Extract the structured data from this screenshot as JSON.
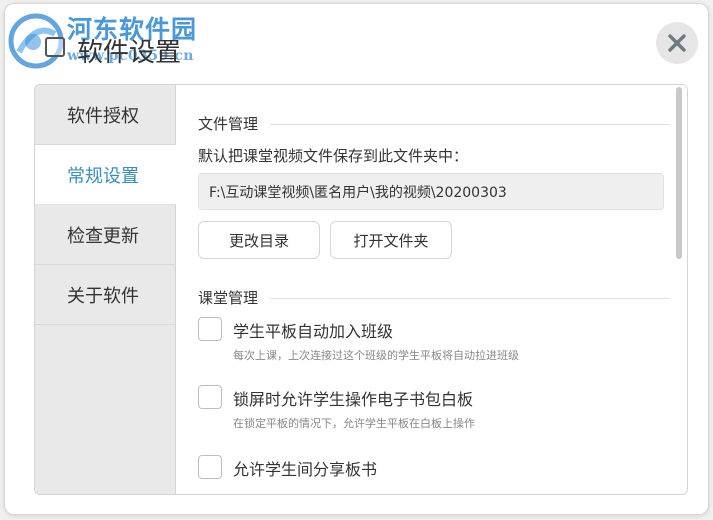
{
  "watermark": {
    "site_name": "河东软件园",
    "site_url": "www.pc0359.cn"
  },
  "header": {
    "title": "软件设置",
    "close_icon": "close-icon"
  },
  "sidebar": {
    "items": [
      {
        "label": "软件授权",
        "active": false
      },
      {
        "label": "常规设置",
        "active": true
      },
      {
        "label": "检查更新",
        "active": false
      },
      {
        "label": "关于软件",
        "active": false
      }
    ]
  },
  "file_section": {
    "title": "文件管理",
    "description": "默认把课堂视频文件保存到此文件夹中：",
    "path": "F:\\互动课堂视频\\匿名用户\\我的视频\\20200303",
    "change_dir_label": "更改目录",
    "open_folder_label": "打开文件夹"
  },
  "class_section": {
    "title": "课堂管理",
    "options": [
      {
        "label": "学生平板自动加入班级",
        "sub": "每次上课，上次连接过这个班级的学生平板将自动拉进班级",
        "checked": false
      },
      {
        "label": "锁屏时允许学生操作电子书包白板",
        "sub": "在锁定平板的情况下，允许学生平板在白板上操作",
        "checked": false
      },
      {
        "label": "允许学生间分享板书",
        "sub": "",
        "checked": false
      }
    ]
  },
  "colors": {
    "accent": "#3a8fc0",
    "watermark": "#3b8fd8",
    "sidebar_bg": "#e9e9e9"
  }
}
